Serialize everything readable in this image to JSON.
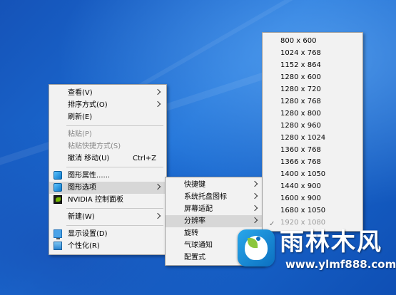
{
  "context_menu": {
    "items": [
      {
        "label": "查看(V)",
        "submenu": true
      },
      {
        "label": "排序方式(O)",
        "submenu": true
      },
      {
        "label": "刷新(E)"
      },
      {
        "label": "粘贴(P)",
        "disabled": true
      },
      {
        "label": "粘贴快捷方式(S)",
        "disabled": true
      },
      {
        "label": "撤消 移动(U)",
        "shortcut": "Ctrl+Z"
      },
      {
        "label": "图形属性......",
        "icon": "graphics-icon"
      },
      {
        "label": "图形选项",
        "icon": "graphics-icon",
        "submenu": true,
        "highlighted": true
      },
      {
        "label": "NVIDIA 控制面板",
        "icon": "nvidia-icon"
      },
      {
        "label": "新建(W)",
        "submenu": true
      },
      {
        "label": "显示设置(D)",
        "icon": "display-icon"
      },
      {
        "label": "个性化(R)",
        "icon": "personalize-icon"
      }
    ]
  },
  "graphics_submenu": {
    "items": [
      {
        "label": "快捷键",
        "submenu": true
      },
      {
        "label": "系统托盘图标",
        "submenu": true
      },
      {
        "label": "屏幕适配",
        "submenu": true
      },
      {
        "label": "分辨率",
        "submenu": true,
        "highlighted": true
      },
      {
        "label": "旋转",
        "submenu": true
      },
      {
        "label": "气球通知"
      },
      {
        "label": "配置式"
      }
    ]
  },
  "resolution_submenu": {
    "items": [
      {
        "label": "800 x 600"
      },
      {
        "label": "1024 x 768"
      },
      {
        "label": "1152 x 864"
      },
      {
        "label": "1280 x 600"
      },
      {
        "label": "1280 x 720"
      },
      {
        "label": "1280 x 768"
      },
      {
        "label": "1280 x 800"
      },
      {
        "label": "1280 x 960"
      },
      {
        "label": "1280 x 1024"
      },
      {
        "label": "1360 x 768"
      },
      {
        "label": "1366 x 768"
      },
      {
        "label": "1400 x 1050"
      },
      {
        "label": "1440 x 900"
      },
      {
        "label": "1600 x 900"
      },
      {
        "label": "1680 x 1050"
      },
      {
        "label": "1920 x 1080",
        "checked": true,
        "disabled": true
      }
    ]
  },
  "watermark": {
    "title": "雨林木风",
    "url": "www.ylmf888.com"
  },
  "colors": {
    "desktop_blue": "#1c6fd6",
    "menu_bg": "#f2f2f2",
    "highlight": "#d7d7d7"
  }
}
